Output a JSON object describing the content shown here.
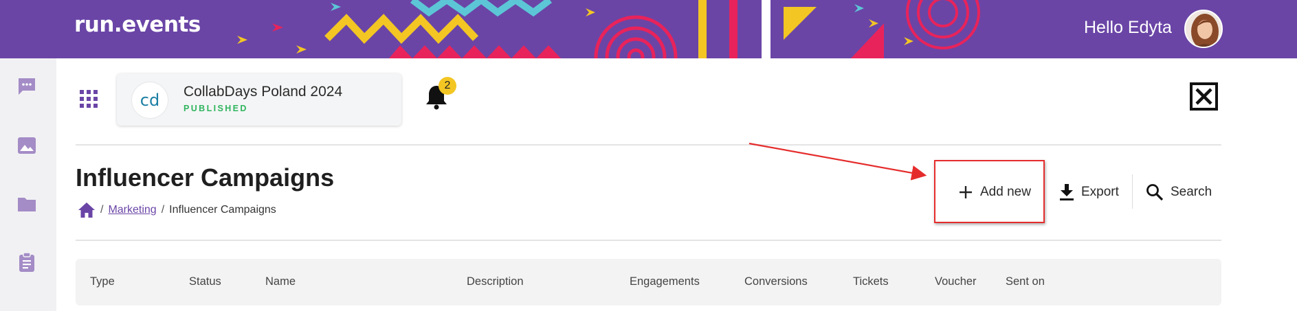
{
  "banner": {
    "logo_text": "run.events",
    "greeting": "Hello Edyta",
    "colors": {
      "purple": "#6a45a6",
      "yellow": "#f3c623",
      "pink": "#e8235b",
      "cyan": "#5cc6d6"
    }
  },
  "rail": {
    "items": [
      {
        "icon": "chat-icon"
      },
      {
        "icon": "image-icon"
      },
      {
        "icon": "folder-icon"
      },
      {
        "icon": "clipboard-icon"
      }
    ]
  },
  "event": {
    "name": "CollabDays Poland 2024",
    "status": "PUBLISHED",
    "logo_text": "cd",
    "notifications_count": "2"
  },
  "page": {
    "title": "Influencer Campaigns",
    "breadcrumb": {
      "home_icon": "home-icon",
      "separator": "/",
      "parent": "Marketing",
      "current": "Influencer Campaigns"
    }
  },
  "toolbar": {
    "add_label": "Add new",
    "export_label": "Export",
    "search_label": "Search"
  },
  "table": {
    "columns": [
      "Type",
      "Status",
      "Name",
      "Description",
      "Engagements",
      "Conversions",
      "Tickets",
      "Voucher",
      "Sent on"
    ]
  }
}
